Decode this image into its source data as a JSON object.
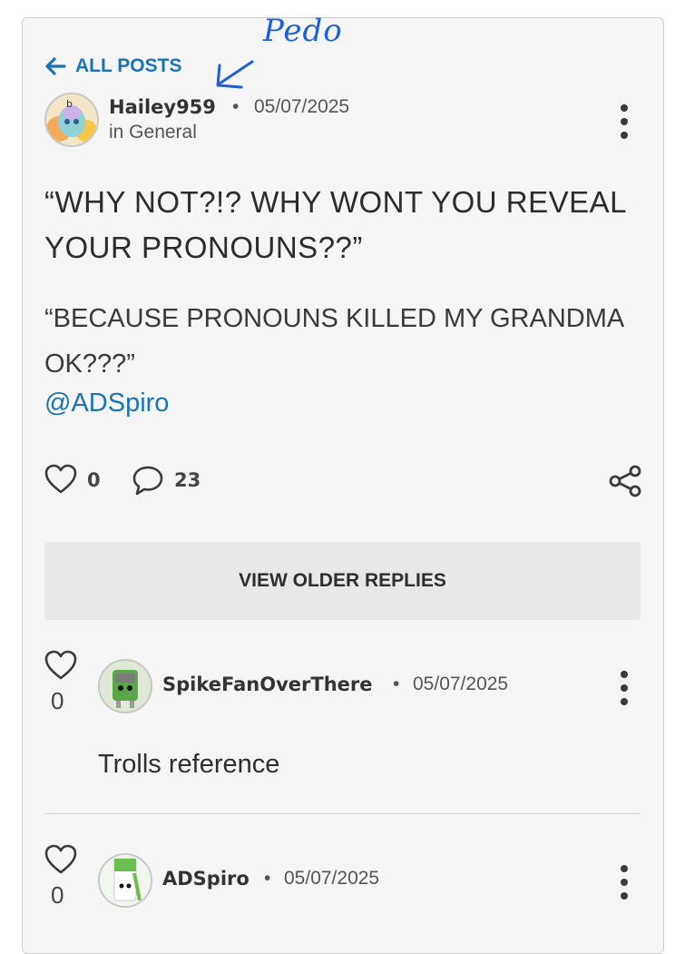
{
  "annotation": {
    "text": "Pedo"
  },
  "nav": {
    "back_label": "ALL POSTS"
  },
  "post": {
    "author": "Hailey959",
    "separator": "•",
    "date": "05/07/2025",
    "category": "in General",
    "title": "“WHY NOT?!? WHY WONT YOU REVEAL YOUR PRONOUNS??”",
    "body": "“BECAUSE PRONOUNS KILLED MY GRANDMA OK???”",
    "mention": "@ADSpiro",
    "likes": "0",
    "comments": "23"
  },
  "view_older_label": "VIEW OLDER REPLIES",
  "replies": [
    {
      "likes": "0",
      "author": "SpikeFanOverThere",
      "separator": "•",
      "date": "05/07/2025",
      "text": "Trolls reference"
    },
    {
      "likes": "0",
      "author": "ADSpiro",
      "separator": "•",
      "date": "05/07/2025"
    }
  ],
  "colors": {
    "link": "#1c74b5",
    "annotation": "#1f5fd6",
    "card_bg": "#f5f5f5"
  }
}
